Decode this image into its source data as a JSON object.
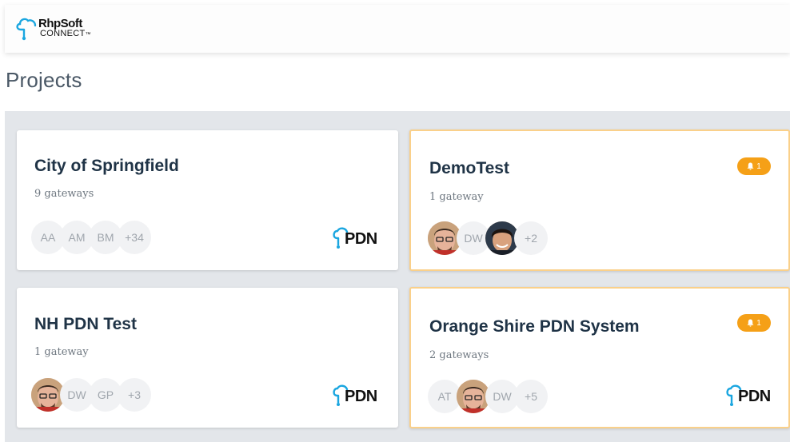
{
  "header": {
    "logo_brand": "RhpSoft",
    "logo_sub": "CONNECT",
    "logo_tm": "™"
  },
  "page": {
    "title": "Projects"
  },
  "colors": {
    "accent": "#f5a017",
    "title": "#1f3346",
    "alert_border": "#fad08a",
    "background": "#e3e6ea"
  },
  "projects": [
    {
      "name": "City of Springfield",
      "gateways": "9 gateways",
      "members": [
        {
          "initials": "AA"
        },
        {
          "initials": "AM"
        },
        {
          "initials": "BM"
        },
        {
          "initials": "+34"
        }
      ],
      "logo": "PDN"
    },
    {
      "name": "DemoTest",
      "gateways": "1 gateway",
      "badge": "1",
      "members": [
        {
          "photo": "avatar-photo-man-glasses"
        },
        {
          "initials": "DW"
        },
        {
          "photo": "avatar-photo-man-smiling"
        },
        {
          "initials": "+2"
        }
      ]
    },
    {
      "name": "NH PDN Test",
      "gateways": "1 gateway",
      "members": [
        {
          "photo": "avatar-photo-man-glasses"
        },
        {
          "initials": "DW"
        },
        {
          "initials": "GP"
        },
        {
          "initials": "+3"
        }
      ],
      "logo": "PDN"
    },
    {
      "name": "Orange Shire PDN System",
      "gateways": "2 gateways",
      "badge": "1",
      "members": [
        {
          "initials": "AT"
        },
        {
          "photo": "avatar-photo-man-glasses"
        },
        {
          "initials": "DW"
        },
        {
          "initials": "+5"
        }
      ],
      "logo": "PDN"
    }
  ]
}
